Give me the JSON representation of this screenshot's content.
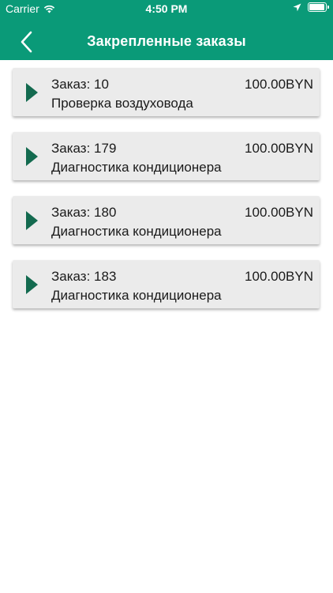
{
  "status_bar": {
    "carrier": "Carrier",
    "time": "4:50 PM",
    "battery_level": 0.95
  },
  "header": {
    "title": "Закрепленные заказы",
    "back_icon": "chevron-left-icon",
    "background_color": "#0a9a78"
  },
  "orders": [
    {
      "order_label": "Заказ: 10",
      "price": "100.00BYN",
      "description": "Проверка воздуховода"
    },
    {
      "order_label": "Заказ: 179",
      "price": "100.00BYN",
      "description": "Диагностика кондиционера"
    },
    {
      "order_label": "Заказ: 180",
      "price": "100.00BYN",
      "description": "Диагностика кондиционера"
    },
    {
      "order_label": "Заказ: 183",
      "price": "100.00BYN",
      "description": "Диагностика кондиционера"
    }
  ],
  "colors": {
    "accent": "#0a9a78",
    "arrow": "#136a4f",
    "card_background": "#ebebeb"
  }
}
